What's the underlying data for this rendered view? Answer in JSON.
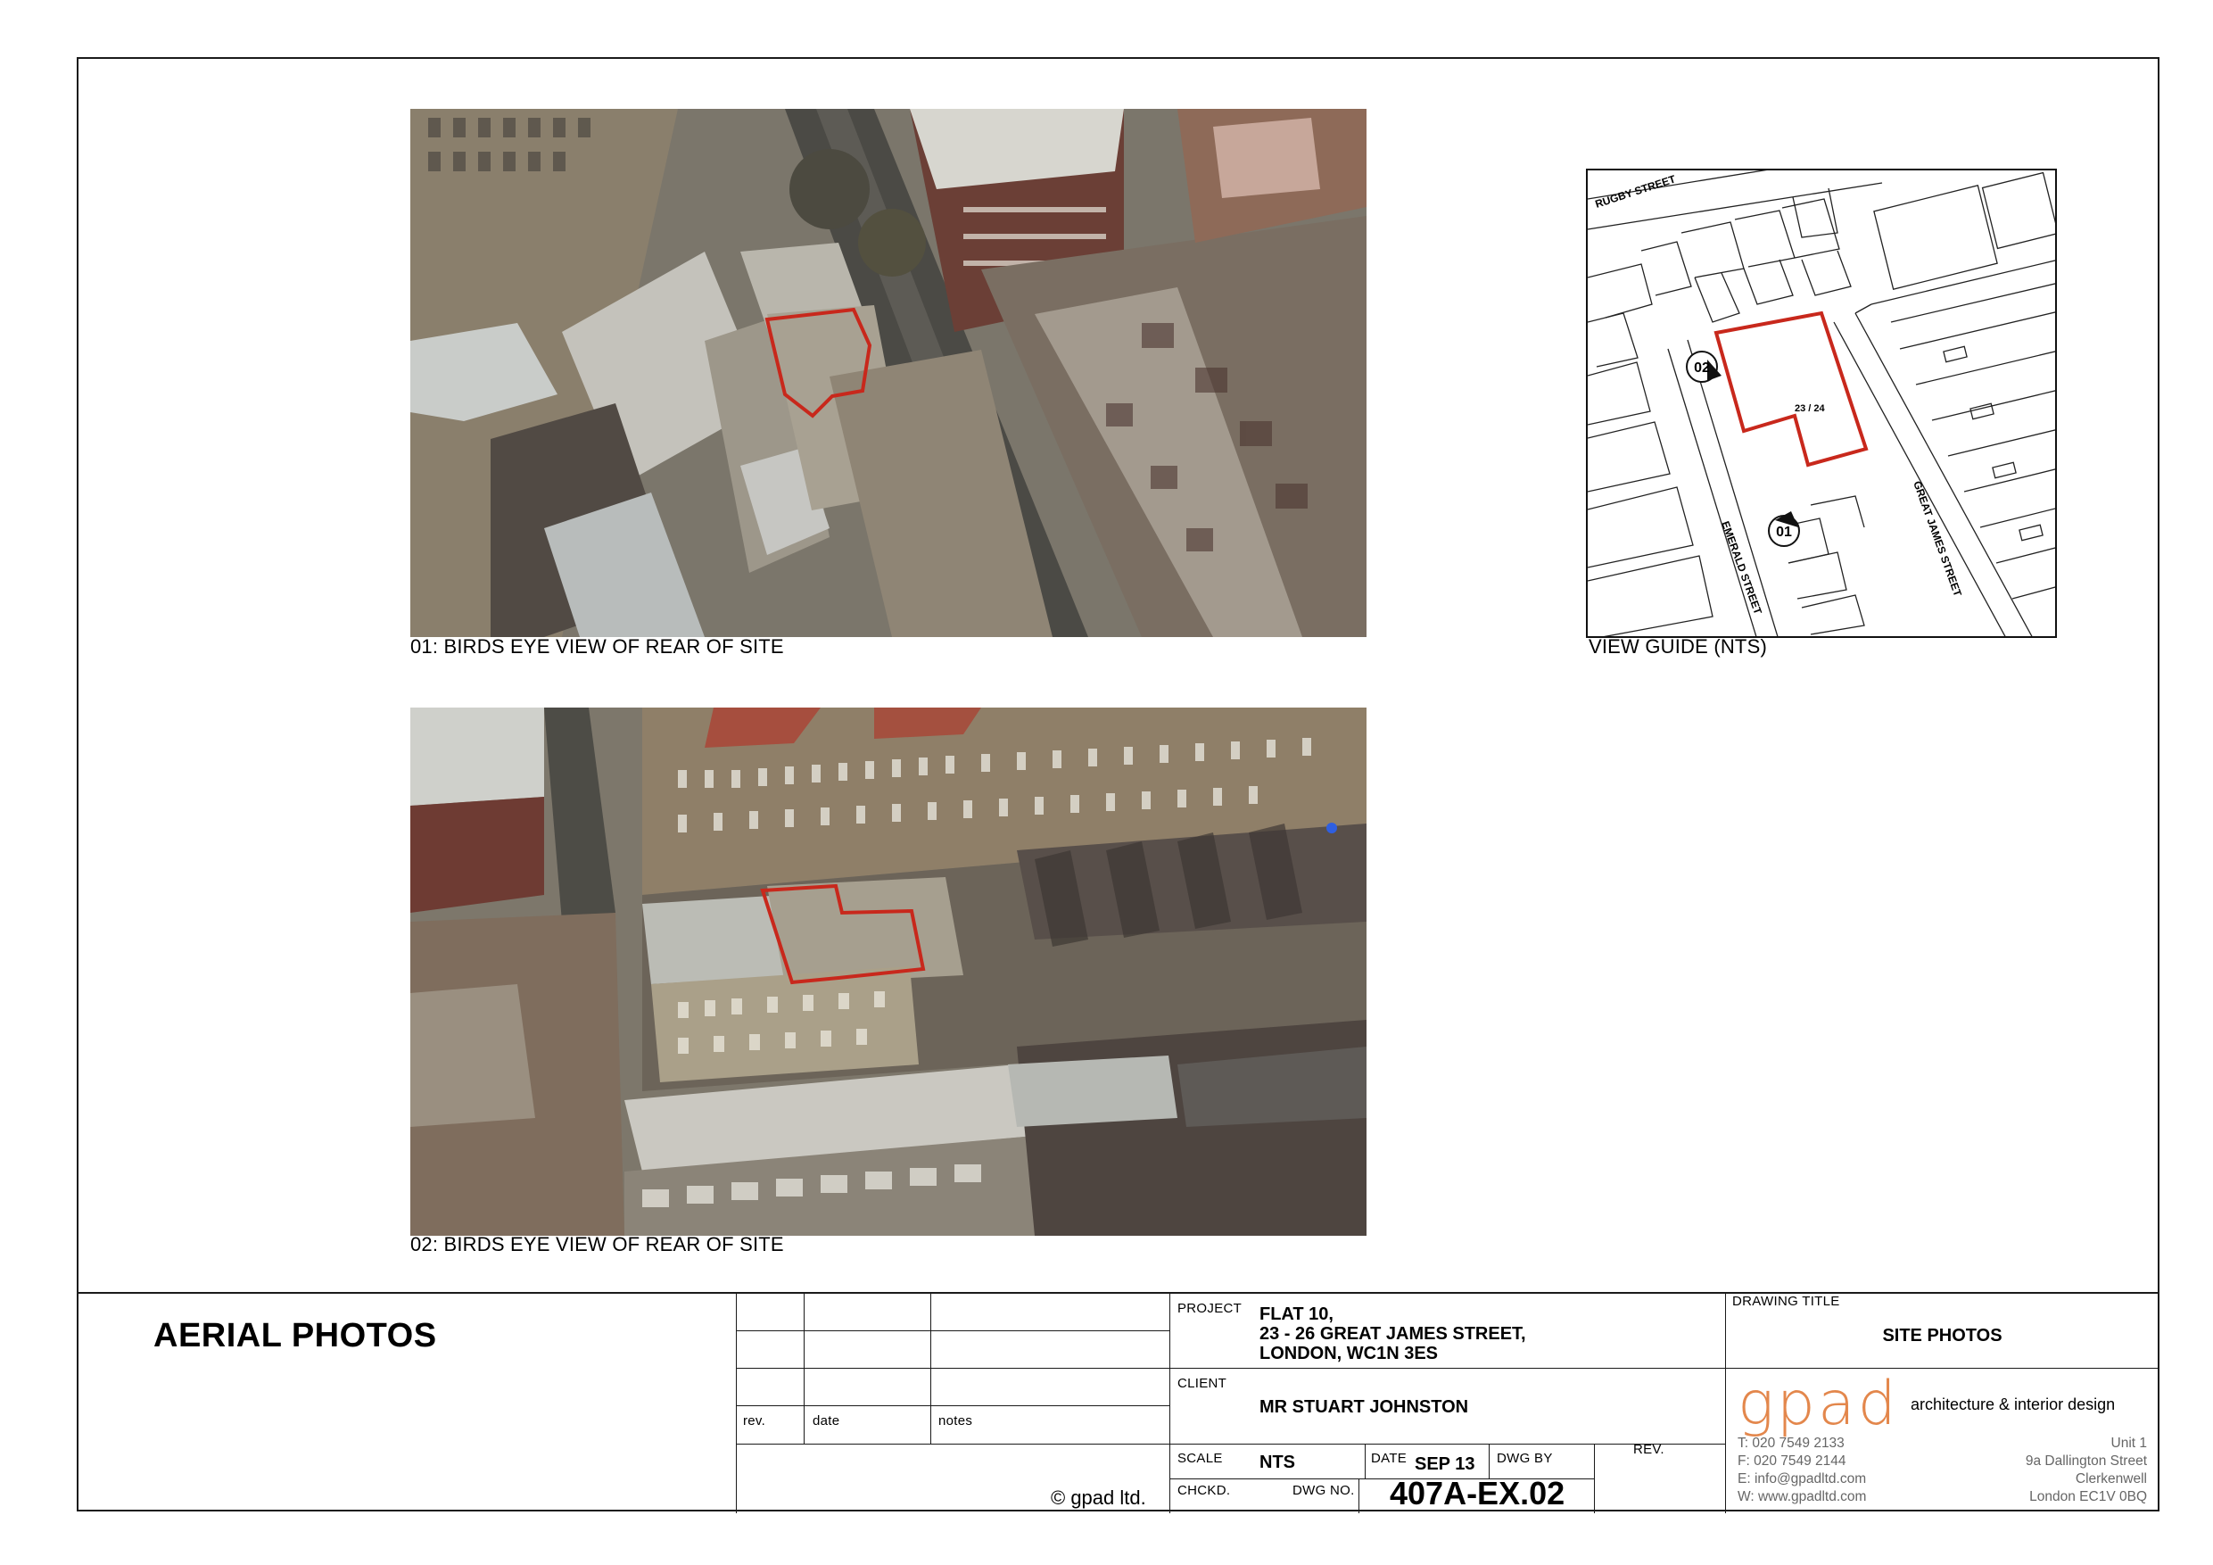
{
  "captions": {
    "photo1": "01: BIRDS EYE VIEW OF REAR OF SITE",
    "photo2": "02: BIRDS EYE VIEW OF REAR OF SITE",
    "guide": "VIEW GUIDE (NTS)"
  },
  "view_guide": {
    "streets": [
      "RUGBY STREET",
      "EMERALD STREET",
      "GREAT JAMES STREET"
    ],
    "site_label": "23 / 24",
    "markers": [
      "01",
      "02"
    ]
  },
  "colors": {
    "site_outline": "#c8281c",
    "brand": "#e3874c"
  },
  "title_block": {
    "sheet_title": "AERIAL PHOTOS",
    "revision_headers": {
      "rev": "rev.",
      "date": "date",
      "notes": "notes"
    },
    "copyright": "© gpad ltd.",
    "project_label": "PROJECT",
    "project_lines": [
      "FLAT 10,",
      "23 - 26 GREAT JAMES STREET,",
      "LONDON, WC1N 3ES"
    ],
    "client_label": "CLIENT",
    "client": "MR STUART JOHNSTON",
    "scale_label": "SCALE",
    "scale": "NTS",
    "date_label": "DATE",
    "date": "SEP 13",
    "dwg_by_label": "DWG BY",
    "rev_label": "REV.",
    "checked_label": "CHCKD.",
    "dwg_no_label": "DWG NO.",
    "dwg_no": "407A-EX.02",
    "drawing_title_label": "DRAWING TITLE",
    "drawing_title": "SITE PHOTOS",
    "logo": "gpad",
    "tagline": "architecture & interior design",
    "contact": [
      "T:  020 7549 2133",
      "F:  020 7549 2144",
      "E:  info@gpadltd.com",
      "W: www.gpadltd.com"
    ],
    "address": [
      "Unit 1",
      "9a Dallington Street",
      "Clerkenwell",
      "London EC1V 0BQ"
    ]
  }
}
